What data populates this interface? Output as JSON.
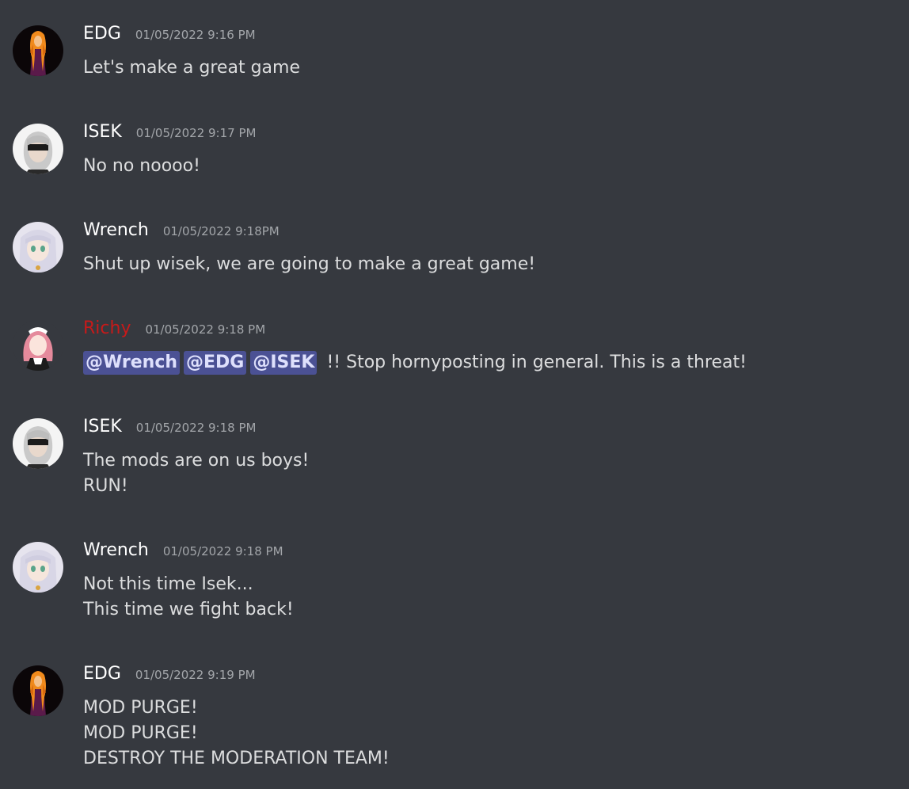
{
  "colors": {
    "background": "#36393f",
    "username_default": "#ffffff",
    "username_moderator": "#c61a1a",
    "timestamp": "#a3a6aa",
    "message_text": "#dcddde",
    "mention_bg": "#4b5194",
    "mention_text": "#dee0fc"
  },
  "messages": [
    {
      "avatar": "edg-avatar",
      "username": "EDG",
      "timestamp": "01/05/2022 9:16 PM",
      "lines": [
        "Let's make a great game"
      ]
    },
    {
      "avatar": "isek-avatar",
      "username": "ISEK",
      "timestamp": "01/05/2022 9:17 PM",
      "lines": [
        "No no noooo!"
      ]
    },
    {
      "avatar": "wrench-avatar",
      "username": "Wrench",
      "timestamp": "01/05/2022 9:18PM",
      "lines": [
        "Shut up wisek, we are going to make a great game!"
      ]
    },
    {
      "avatar": "richy-avatar",
      "username": "Richy",
      "timestamp": "01/05/2022 9:18 PM",
      "mentions": [
        "@Wrench",
        "@EDG",
        "@ISEK"
      ],
      "text_after_mentions": " !! Stop hornyposting in general. This is a threat!"
    },
    {
      "avatar": "isek-avatar",
      "username": "ISEK",
      "timestamp": "01/05/2022 9:18 PM",
      "lines": [
        "The mods are on us boys!",
        "RUN!"
      ]
    },
    {
      "avatar": "wrench-avatar",
      "username": "Wrench",
      "timestamp": "01/05/2022 9:18 PM",
      "lines": [
        "Not this time Isek...",
        "This time we fight back!"
      ]
    },
    {
      "avatar": "edg-avatar",
      "username": "EDG",
      "timestamp": "01/05/2022 9:19 PM",
      "lines": [
        "MOD PURGE!",
        "MOD PURGE!",
        "DESTROY THE MODERATION TEAM!"
      ]
    }
  ]
}
